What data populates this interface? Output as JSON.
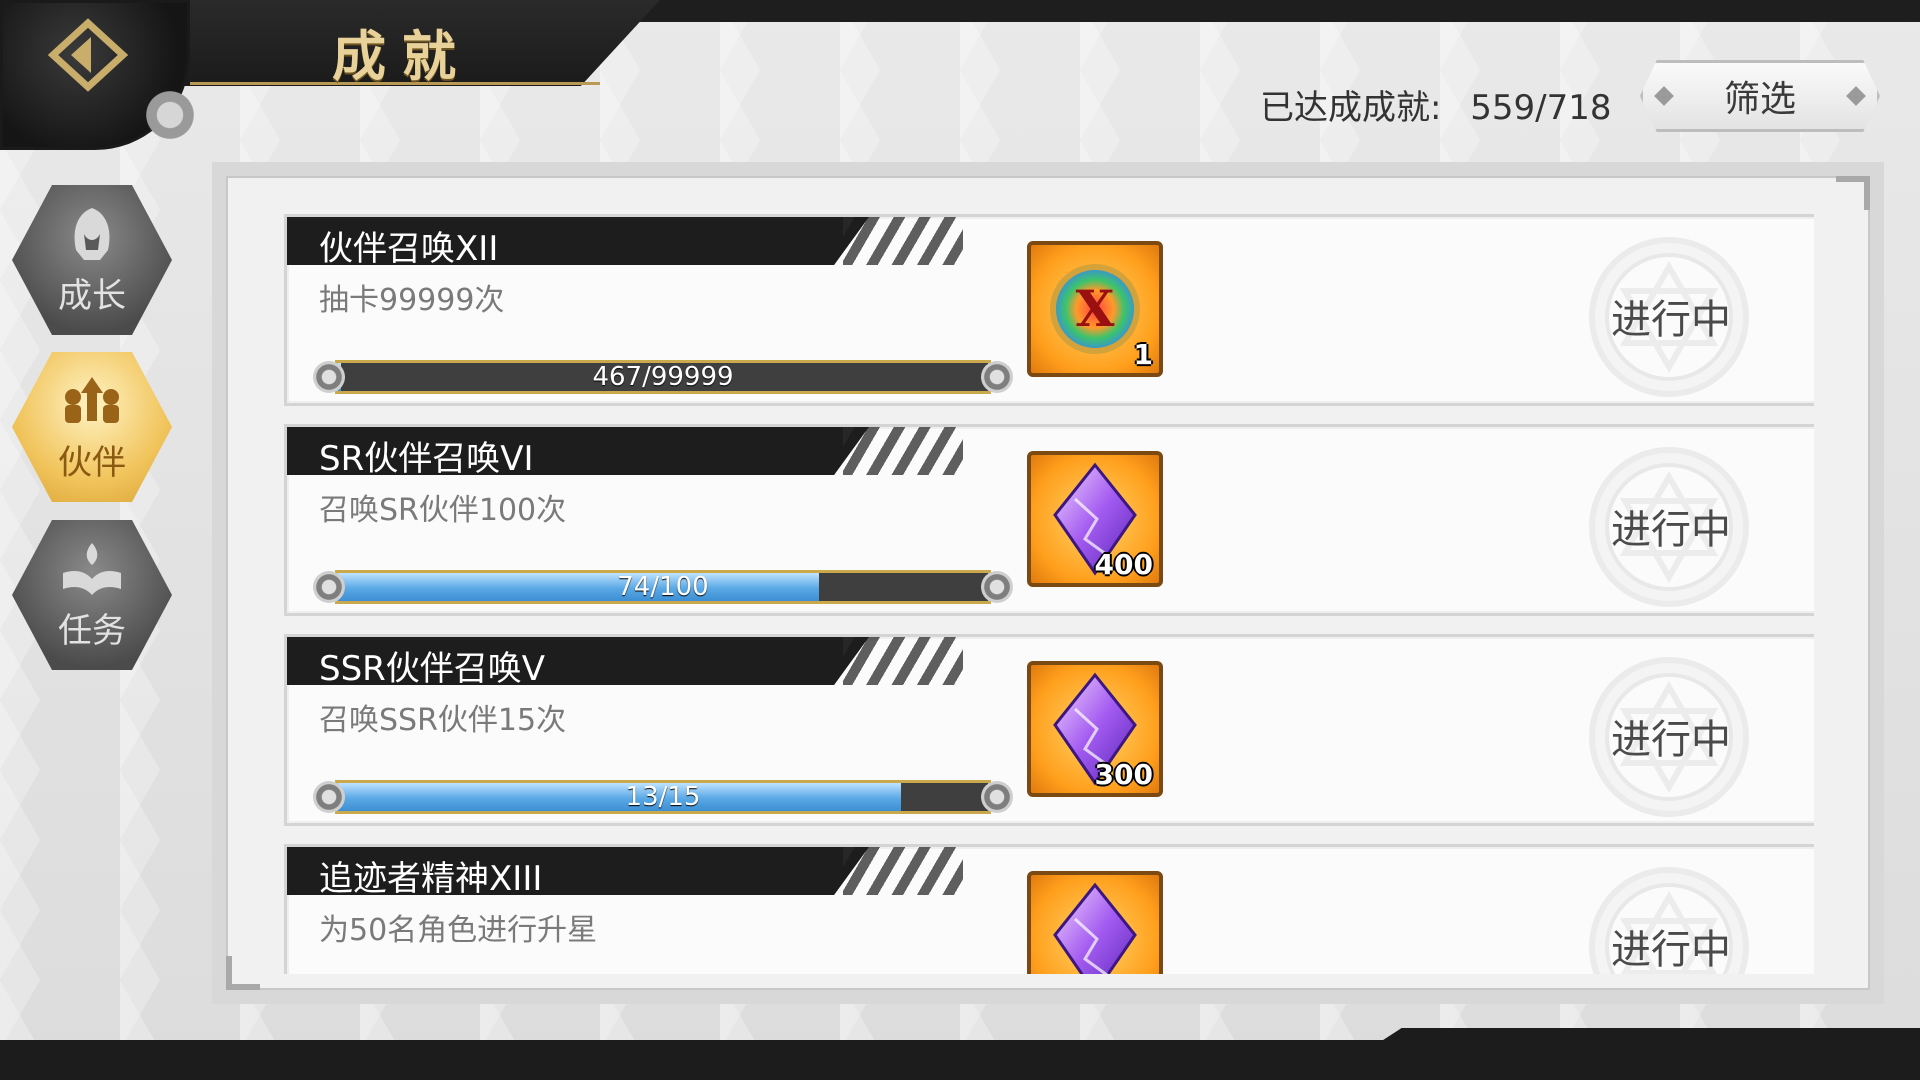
{
  "header": {
    "title": "成就",
    "achievement_label": "已达成成就:",
    "achievement_value": "559/718",
    "filter_label": "筛选"
  },
  "sidebar": {
    "tabs": [
      {
        "label": "成长",
        "icon": "hooded-figure-icon",
        "active": false
      },
      {
        "label": "伙伴",
        "icon": "party-group-icon",
        "active": true
      },
      {
        "label": "任务",
        "icon": "book-flame-icon",
        "active": false
      }
    ]
  },
  "achievements": [
    {
      "title": "伙伴召唤XII",
      "description": "抽卡99999次",
      "progress_text": "467/99999",
      "progress_fraction": 0.0047,
      "reward_icon": "x-medal-icon",
      "reward_qty": "1",
      "status": "进行中"
    },
    {
      "title": "SR伙伴召唤VI",
      "description": "召唤SR伙伴100次",
      "progress_text": "74/100",
      "progress_fraction": 0.74,
      "reward_icon": "purple-crystal-icon",
      "reward_qty": "400",
      "status": "进行中"
    },
    {
      "title": "SSR伙伴召唤V",
      "description": "召唤SSR伙伴15次",
      "progress_text": "13/15",
      "progress_fraction": 0.8667,
      "reward_icon": "purple-crystal-icon",
      "reward_qty": "300",
      "status": "进行中"
    },
    {
      "title": "追迹者精神XIII",
      "description": "为50名角色进行升星",
      "progress_text": "",
      "reward_icon": "purple-crystal-icon",
      "reward_qty": "",
      "status": "进行中"
    }
  ],
  "colors": {
    "accent_gold": "#e9d29a",
    "progress_blue": "#5aa8e6",
    "reward_orange": "#ff9f1c",
    "active_tab": "#f1c45c"
  }
}
